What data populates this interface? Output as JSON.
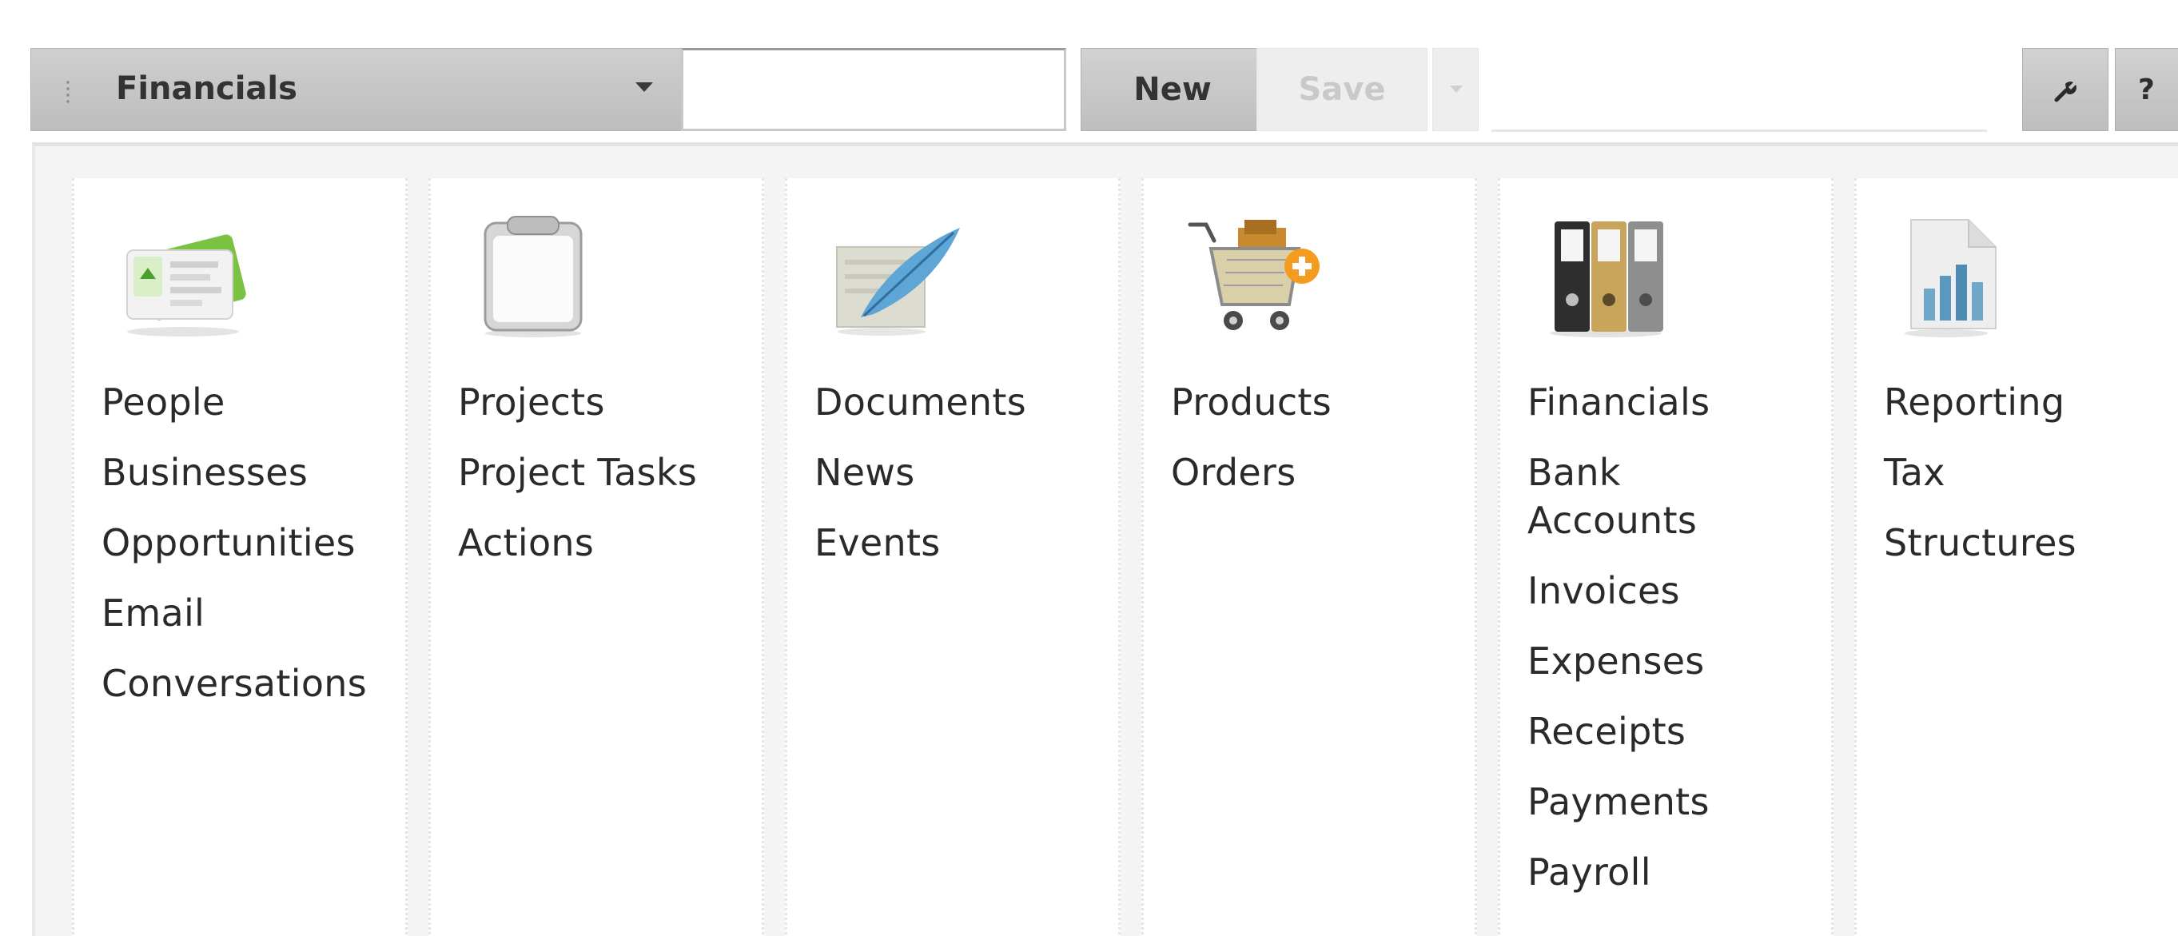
{
  "toolbar": {
    "module_select": {
      "selected": "Financials"
    },
    "search": {
      "value": "",
      "placeholder": ""
    },
    "new_label": "New",
    "save_label": "Save",
    "help_label": "?"
  },
  "menu": {
    "columns": [
      {
        "icon": "contacts-card-icon",
        "items": [
          "People",
          "Businesses",
          "Opportunities",
          "Email",
          "Conversations"
        ]
      },
      {
        "icon": "clipboard-icon",
        "items": [
          "Projects",
          "Project Tasks",
          "Actions"
        ]
      },
      {
        "icon": "quill-document-icon",
        "items": [
          "Documents",
          "News",
          "Events"
        ]
      },
      {
        "icon": "shopping-cart-add-icon",
        "items": [
          "Products",
          "Orders"
        ]
      },
      {
        "icon": "binders-icon",
        "items": [
          "Financials",
          "Bank Accounts",
          "Invoices",
          "Expenses",
          "Receipts",
          "Payments",
          "Payroll"
        ]
      },
      {
        "icon": "report-chart-icon",
        "items": [
          "Reporting",
          "Tax",
          "Structures"
        ]
      }
    ]
  },
  "colors": {
    "toolbar_button": "#c6c6c6",
    "disabled_text": "#c9c9c9",
    "panel_background": "#f4f4f4",
    "link_text": "#2a2a2a"
  }
}
